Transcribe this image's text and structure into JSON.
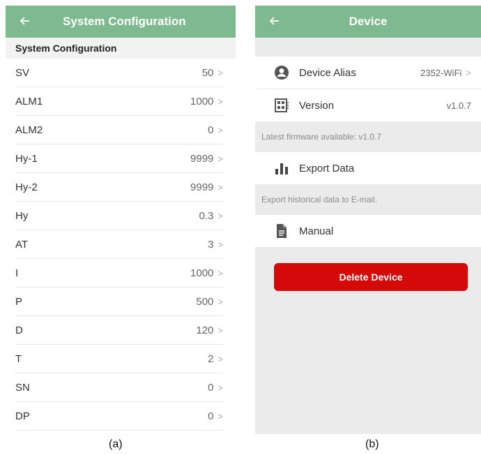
{
  "left": {
    "header": {
      "title": "System Configuration",
      "back_icon": "arrow-left-icon"
    },
    "section_title": "System Configuration",
    "rows": [
      {
        "label": "SV",
        "value": "50"
      },
      {
        "label": "ALM1",
        "value": "1000"
      },
      {
        "label": "ALM2",
        "value": "0"
      },
      {
        "label": "Hy-1",
        "value": "9999"
      },
      {
        "label": "Hy-2",
        "value": "9999"
      },
      {
        "label": "Hy",
        "value": "0.3"
      },
      {
        "label": "AT",
        "value": "3"
      },
      {
        "label": "I",
        "value": "1000"
      },
      {
        "label": "P",
        "value": "500"
      },
      {
        "label": "D",
        "value": "120"
      },
      {
        "label": "T",
        "value": "2"
      },
      {
        "label": "SN",
        "value": "0"
      },
      {
        "label": "DP",
        "value": "0"
      }
    ],
    "caption": "(a)"
  },
  "right": {
    "header": {
      "title": "Device",
      "back_icon": "arrow-left-icon"
    },
    "alias": {
      "label": "Device Alias",
      "value": "2352-WiFi",
      "icon": "person-icon"
    },
    "version": {
      "label": "Version",
      "value": "v1.0.7",
      "icon": "firmware-icon"
    },
    "firmware_note": "Latest firmware available: v1.0.7",
    "export": {
      "label": "Export Data",
      "icon": "bar-chart-icon"
    },
    "export_note": "Export historical data to E-mail.",
    "manual": {
      "label": "Manual",
      "icon": "document-icon"
    },
    "delete_label": "Delete Device",
    "caption": "(b)"
  },
  "colors": {
    "header": "#7fb98f",
    "delete": "#d40a0a"
  }
}
